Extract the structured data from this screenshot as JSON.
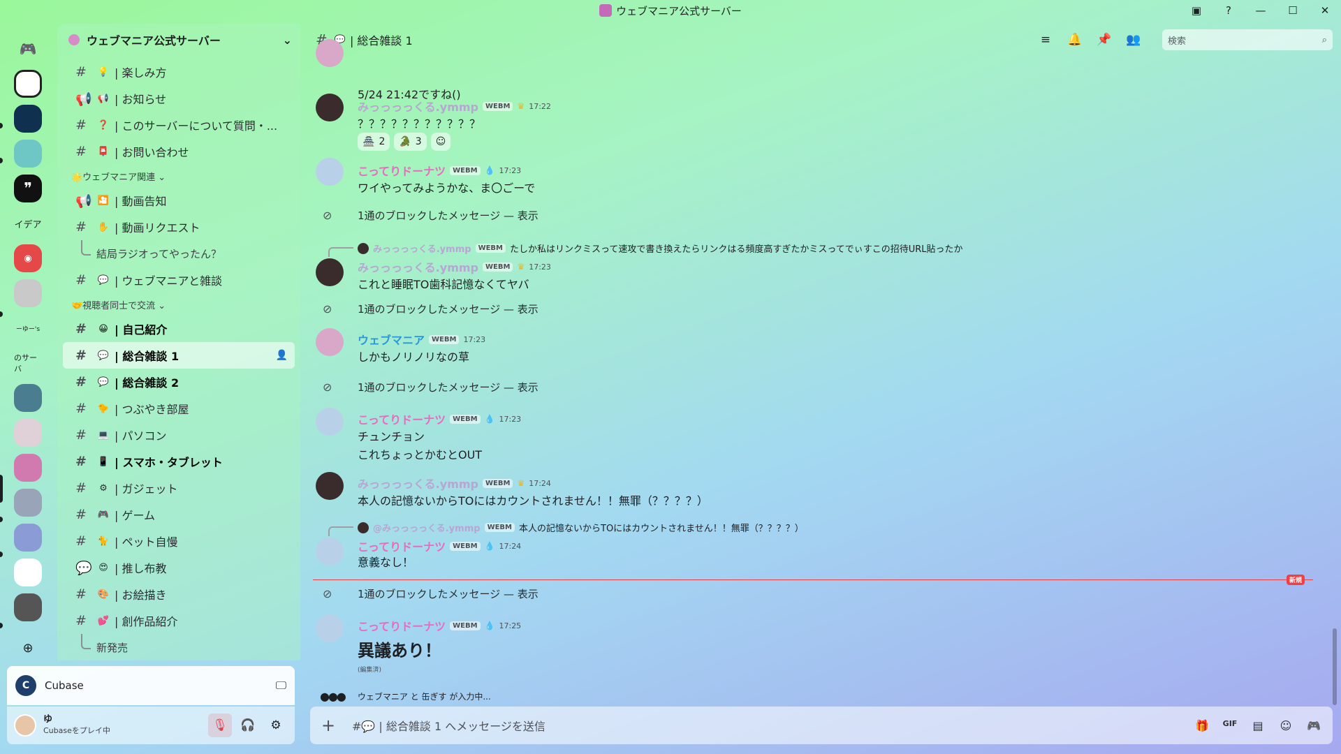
{
  "window": {
    "title": "ウェブマニア公式サーバー"
  },
  "server": {
    "name": "ウェブマニア公式サーバー"
  },
  "channels": {
    "top": [
      {
        "emoji": "💡",
        "label": "| 楽しみ方"
      },
      {
        "emoji": "📢",
        "label": "| お知らせ"
      },
      {
        "emoji": "❓",
        "label": "| このサーバーについて質問・..."
      },
      {
        "emoji": "📮",
        "label": "| お問い合わせ"
      }
    ],
    "cat1": "🌟ウェブマニア関連",
    "cat1_items": [
      {
        "emoji": "🎦",
        "label": "| 動画告知"
      },
      {
        "emoji": "✋",
        "label": "| 動画リクエスト"
      }
    ],
    "thread1": "結局ラジオってやったん？",
    "cat1_items2": [
      {
        "emoji": "💬",
        "label": "| ウェブマニアと雑談"
      }
    ],
    "cat2": "🤝視聴者同士で交流",
    "cat2_items": [
      {
        "emoji": "😀",
        "label": "| 自己紹介"
      },
      {
        "emoji": "💬",
        "label": "| 総合雑談 1"
      },
      {
        "emoji": "💬",
        "label": "| 総合雑談 2"
      },
      {
        "emoji": "🐤",
        "label": "| つぶやき部屋"
      },
      {
        "emoji": "💻",
        "label": "| パソコン"
      },
      {
        "emoji": "📱",
        "label": "| スマホ・タブレット"
      },
      {
        "emoji": "⚙",
        "label": "| ガジェット"
      },
      {
        "emoji": "🎮",
        "label": "| ゲーム"
      },
      {
        "emoji": "🐈",
        "label": "| ペット自慢"
      },
      {
        "emoji": "😍",
        "label": "| 推し布教"
      },
      {
        "emoji": "🎨",
        "label": "| お絵描き"
      },
      {
        "emoji": "💕",
        "label": "| 創作品紹介"
      }
    ],
    "thread2": "新発売"
  },
  "rail": {
    "idea": "イデア",
    "yu": "ーゆー's",
    "server_text": "のサーバ"
  },
  "activity": {
    "app": "Cubase"
  },
  "user": {
    "name": "ゆ",
    "status": "Cubaseをプレイ中"
  },
  "header": {
    "channel": "| 総合雑談 1",
    "search_placeholder": "検索"
  },
  "messages": {
    "m0": {
      "text": "5/24 21:42ですね()"
    },
    "m1": {
      "user": "みっっっっくる.ymmp",
      "tag": "WEBM",
      "time": "17:22",
      "text": "？？？？？？？？？？？",
      "r1": "2",
      "r2": "3"
    },
    "m2": {
      "user": "こってりドーナツ",
      "tag": "WEBM",
      "time": "17:23",
      "text": "ワイやってみようかな、ま〇ごーで"
    },
    "blocked": "1通のブロックしたメッセージ — 表示",
    "m3": {
      "reply_user": "みっっっっくる.ymmp",
      "reply_tag": "WEBM",
      "reply_text": "たしか私はリンクミスって速攻で書き換えたらリンクはる頻度高すぎたかミスってでぃすこの招待URL貼ったか",
      "user": "みっっっっくる.ymmp",
      "tag": "WEBM",
      "time": "17:23",
      "text": "これと睡眠TO歯科記憶なくてヤバ"
    },
    "m4": {
      "user": "ウェブマニア",
      "tag": "WEBM",
      "time": "17:23",
      "text": "しかもノリノリなの草"
    },
    "m5": {
      "user": "こってりドーナツ",
      "tag": "WEBM",
      "time": "17:23",
      "text1": "チュンチョン",
      "text2": "これちょっとかむとOUT"
    },
    "m6": {
      "user": "みっっっっくる.ymmp",
      "tag": "WEBM",
      "time": "17:24",
      "text": "本人の記憶ないからTOにはカウントされません！！無罪（？？？？）"
    },
    "m7": {
      "reply_user": "@みっっっっくる.ymmp",
      "reply_tag": "WEBM",
      "reply_text": "本人の記憶ないからTOにはカウントされません！！無罪（？？？？）",
      "user": "こってりドーナツ",
      "tag": "WEBM",
      "time": "17:24",
      "text": "意義なし！"
    },
    "m8": {
      "user": "こってりドーナツ",
      "tag": "WEBM",
      "time": "17:25",
      "text": "異議あり！",
      "edited": "(編集済)"
    },
    "new_badge": "新規"
  },
  "typing": {
    "names": "ウェブマニア と 缶ぎす が入力中..."
  },
  "composer": {
    "placeholder": "#💬 | 総合雑談 1 へメッセージを送信",
    "gif": "GIF"
  },
  "colors": {
    "accent_green": "#9af79a",
    "mention_red": "#f23f43",
    "kotteri": "#e86bbf",
    "webmania": "#2a98d8",
    "mitsu": "#b9a5d3"
  }
}
